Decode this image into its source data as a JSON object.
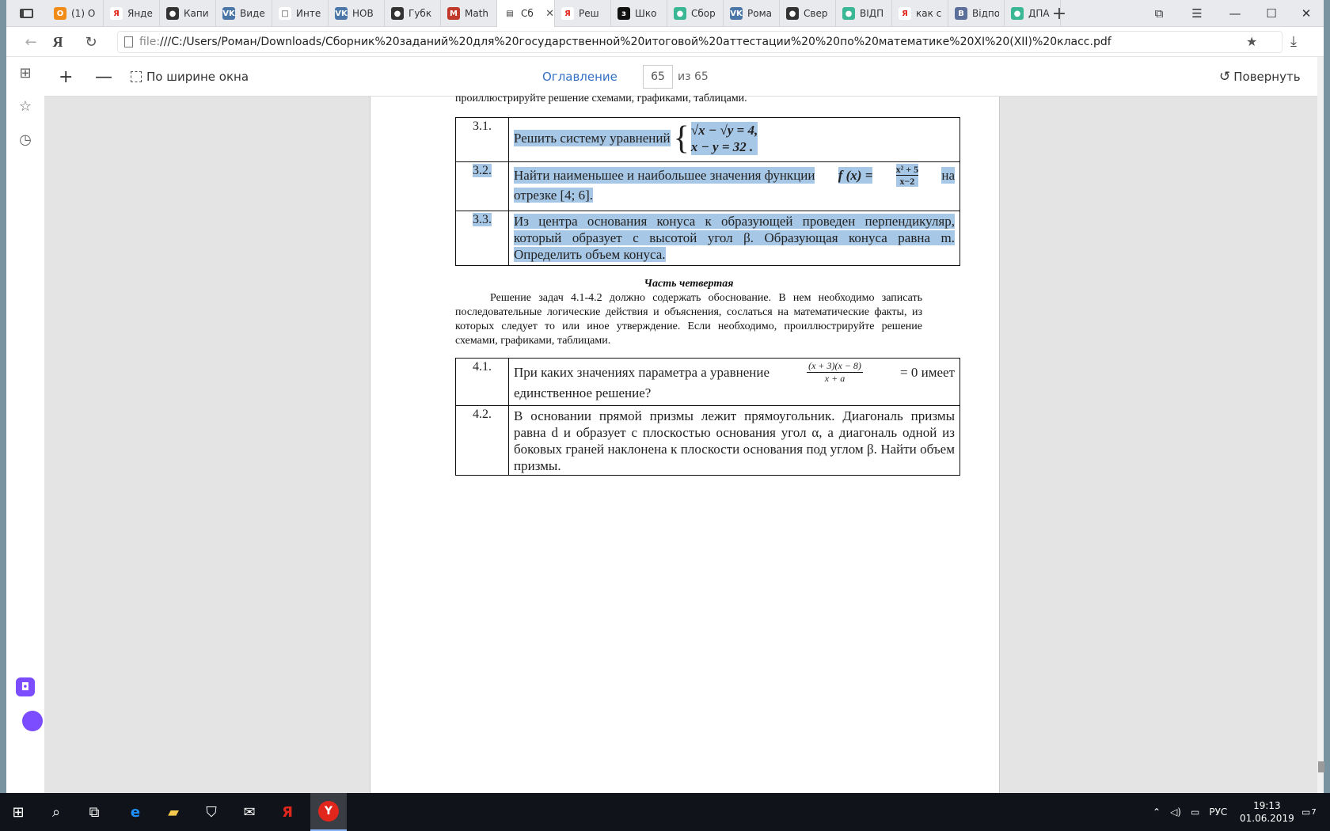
{
  "tabs": [
    {
      "label": "(1) О",
      "fav": "О",
      "color": "#f28c18"
    },
    {
      "label": "Янде",
      "fav": "Я",
      "color": "#ffffff",
      "text": "#e1261c"
    },
    {
      "label": "Капи",
      "fav": "●",
      "color": "#333333"
    },
    {
      "label": "Виде",
      "fav": "VK",
      "color": "#4a76a8"
    },
    {
      "label": "Инте",
      "fav": "□",
      "color": "#ffffff",
      "text": "#444444"
    },
    {
      "label": "НОВ",
      "fav": "VK",
      "color": "#4a76a8"
    },
    {
      "label": "Губк",
      "fav": "●",
      "color": "#333333"
    },
    {
      "label": "Math",
      "fav": "M",
      "color": "#c0392b"
    },
    {
      "label": "Сб",
      "fav": "▤",
      "color": "#ffffff",
      "text": "#333333",
      "active": true
    },
    {
      "label": "Реш",
      "fav": "Я",
      "color": "#ffffff",
      "text": "#e1261c"
    },
    {
      "label": "Шко",
      "fav": "з",
      "color": "#111111"
    },
    {
      "label": "Сбор",
      "fav": "●",
      "color": "#3ab795"
    },
    {
      "label": "Рома",
      "fav": "VK",
      "color": "#4a76a8"
    },
    {
      "label": "Свер",
      "fav": "●",
      "color": "#333333"
    },
    {
      "label": "ВІДП",
      "fav": "●",
      "color": "#3ab795"
    },
    {
      "label": "как с",
      "fav": "Я",
      "color": "#ffffff",
      "text": "#e1261c"
    },
    {
      "label": "Відпо",
      "fav": "В",
      "color": "#5b6f9a"
    },
    {
      "label": "ДПА",
      "fav": "●",
      "color": "#3ab795"
    }
  ],
  "address": {
    "scheme": "file:",
    "path": "///C:/Users/Роман/Downloads/Сборник%20заданий%20для%20государственной%20итоговой%20аттестации%20%20по%20математике%20XI%20(XII)%20класс.pdf"
  },
  "toolbar": {
    "fit_width": "По ширине окна",
    "toc": "Оглавление",
    "page_current": "65",
    "page_total": "из 65",
    "rotate": "Повернуть"
  },
  "doc": {
    "top_line": "проиллюстрируйте решение схемами, графиками, таблицами.",
    "part3": [
      {
        "num": "3.1.",
        "text": "Решить  систему уравнений",
        "eq1": "√x  − √y  = 4,",
        "eq2": "x  −  y = 32 ."
      },
      {
        "num": "3.2.",
        "text": "Найти наименьшее и наибольшее значения функции",
        "func": "f (x) =",
        "frac_num": "x² + 5",
        "frac_den": "x−2",
        "tail": "на",
        "line2": "отрезке [4; 6]."
      },
      {
        "num": "3.3.",
        "text": "Из центра основания конуса к образующей проведен перпендикуляр, который образует с высотой угол β. Образующая конуса равна m. Определить объем конуса."
      }
    ],
    "part4_title": "Часть четвертая",
    "part4_intro": "Решение задач 4.1-4.2 должно содержать обоснование. В нем необходимо записать последовательные логические действия и объяснения, сослаться на математические факты, из которых следует то или иное утверждение. Если необходимо, проиллюстрируйте решение схемами, графиками, таблицами.",
    "part4": [
      {
        "num": "4.1.",
        "text": "При каких значениях параметра a уравнение",
        "frac_num": "(x + 3)(x − 8)",
        "frac_den": "x + a",
        "tail": "= 0 имеет",
        "line2": "единственное решение?"
      },
      {
        "num": "4.2.",
        "text": "В основании прямой призмы лежит прямоугольник. Диагональ призмы равна d и образует с плоскостью основания угол α, а диагональ одной из боковых граней наклонена к плоскости основания под углом β. Найти объем призмы."
      }
    ]
  },
  "taskbar": {
    "lang": "РУС",
    "time": "19:13",
    "date": "01.06.2019",
    "notif_count": "7"
  }
}
